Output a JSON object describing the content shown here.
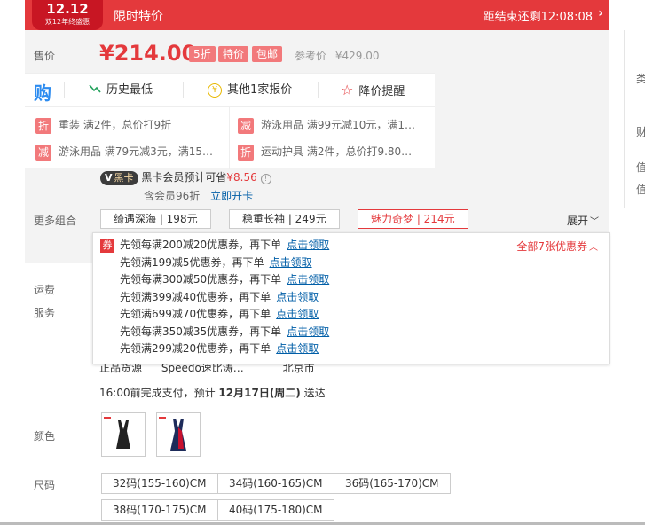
{
  "banner": {
    "badge_top": "12.12",
    "badge_sub": "双12年终盛惠",
    "title": "限时特价",
    "countdown": "距结束还剩12:08:08",
    "arrow": "›"
  },
  "price": {
    "label": "售价",
    "value": "¥214.00",
    "tags": [
      "5折",
      "特价",
      "包邮"
    ],
    "ref_label": "参考价",
    "ref_value": "¥429.00"
  },
  "tools": {
    "icon": "购",
    "history": "历史最低",
    "other_price": "其他1家报价",
    "price_alert": "降价提醒"
  },
  "promos": [
    {
      "badge": "折",
      "text": "重装 满2件，总价打9折"
    },
    {
      "badge": "减",
      "text": "游泳用品 满99元减10元，满1…"
    },
    {
      "badge": "减",
      "text": "游泳用品 满79元减3元，满15…"
    },
    {
      "badge": "折",
      "text": "运动护具 满2件，总价打9.80…"
    }
  ],
  "black_card": {
    "badge": "黑卡",
    "text": "黑卡会员预计可省",
    "amount": "¥8.56",
    "info": "!",
    "line2": "含会员96折",
    "open_link": "立即开卡"
  },
  "combos": {
    "label": "更多组合",
    "items": [
      "绮遇深海 | 198元",
      "稳重长袖 | 249元",
      "魅力奇梦 | 214元"
    ],
    "expand": "展开"
  },
  "coupons": {
    "badge": "券",
    "all": "全部7张优惠券",
    "claim": "点击领取",
    "items": [
      "先领每满200减20优惠券，再下单",
      "先领满199减5优惠券，再下单",
      "先领每满300减50优惠券，再下单",
      "先领满399减40优惠券，再下单",
      "先领满699减70优惠券，再下单",
      "先领每满350减35优惠券，再下单",
      "先领满299减20优惠券，再下单"
    ]
  },
  "lower": {
    "shipping_label": "运费",
    "service_label": "服务",
    "store_items": [
      "正品货源",
      "Speedo速比涛…",
      "北京市"
    ],
    "delivery_prefix": "16:00前完成支付，预计",
    "delivery_date": "12月17日(周二)",
    "delivery_suffix": "送达",
    "color_label": "颜色",
    "size_label": "尺码",
    "sizes": [
      "32码(155-160)CM",
      "34码(160-165)CM",
      "36码(165-170)CM",
      "38码(170-175)CM",
      "40码(175-180)CM"
    ]
  },
  "right_strip": {
    "items": [
      "类",
      "财",
      "值",
      "值"
    ]
  },
  "colors": {
    "accent": "#e4393c",
    "tag": "#f2797b",
    "link": "#005ea7"
  }
}
